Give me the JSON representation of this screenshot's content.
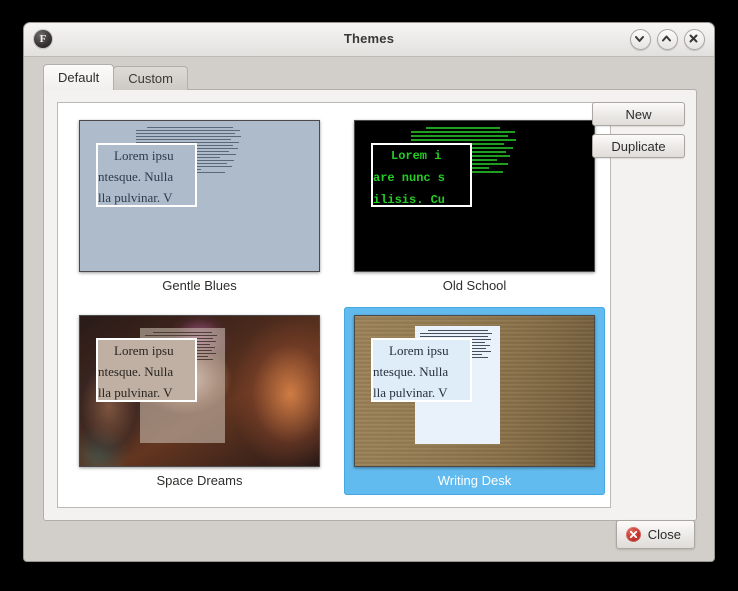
{
  "window": {
    "title": "Themes",
    "app_icon": "focuswriter-icon",
    "icon_letter": "F",
    "controls": [
      {
        "name": "minimize",
        "icon": "chevron-down-icon"
      },
      {
        "name": "maximize",
        "icon": "chevron-up-icon"
      },
      {
        "name": "close",
        "icon": "close-x-icon"
      }
    ]
  },
  "tabs": [
    {
      "label": "Default",
      "active": true
    },
    {
      "label": "Custom",
      "active": false
    }
  ],
  "side_buttons": {
    "new_label": "New",
    "duplicate_label": "Duplicate"
  },
  "footer": {
    "close_label": "Close",
    "close_icon": "red-circle-x-icon"
  },
  "sample_text": {
    "lines": [
      "Lorem ipsu",
      "ntesque. Nulla",
      "lla pulvinar. V"
    ],
    "mono_lines": [
      "Lorem i",
      "are nunc s",
      "ilisis. Cu"
    ]
  },
  "themes": [
    {
      "name": "Gentle Blues",
      "selected": false,
      "background_color": "#aebbcb",
      "text_color": "#2c3a4c",
      "preview_style": "flat-blue"
    },
    {
      "name": "Old School",
      "selected": false,
      "background_color": "#000000",
      "text_color": "#24cc24",
      "preview_style": "terminal-green"
    },
    {
      "name": "Space Dreams",
      "selected": false,
      "background_color": "#4a2a1e",
      "text_color": "#2a2420",
      "preview_style": "nebula-photo"
    },
    {
      "name": "Writing Desk",
      "selected": true,
      "background_color": "#95794f",
      "text_color": "#263040",
      "preview_style": "wood-desk"
    }
  ],
  "colors": {
    "selection_blue": "#62bbee",
    "dialog_gray": "#d2cec9",
    "panel_white": "#ffffff"
  }
}
